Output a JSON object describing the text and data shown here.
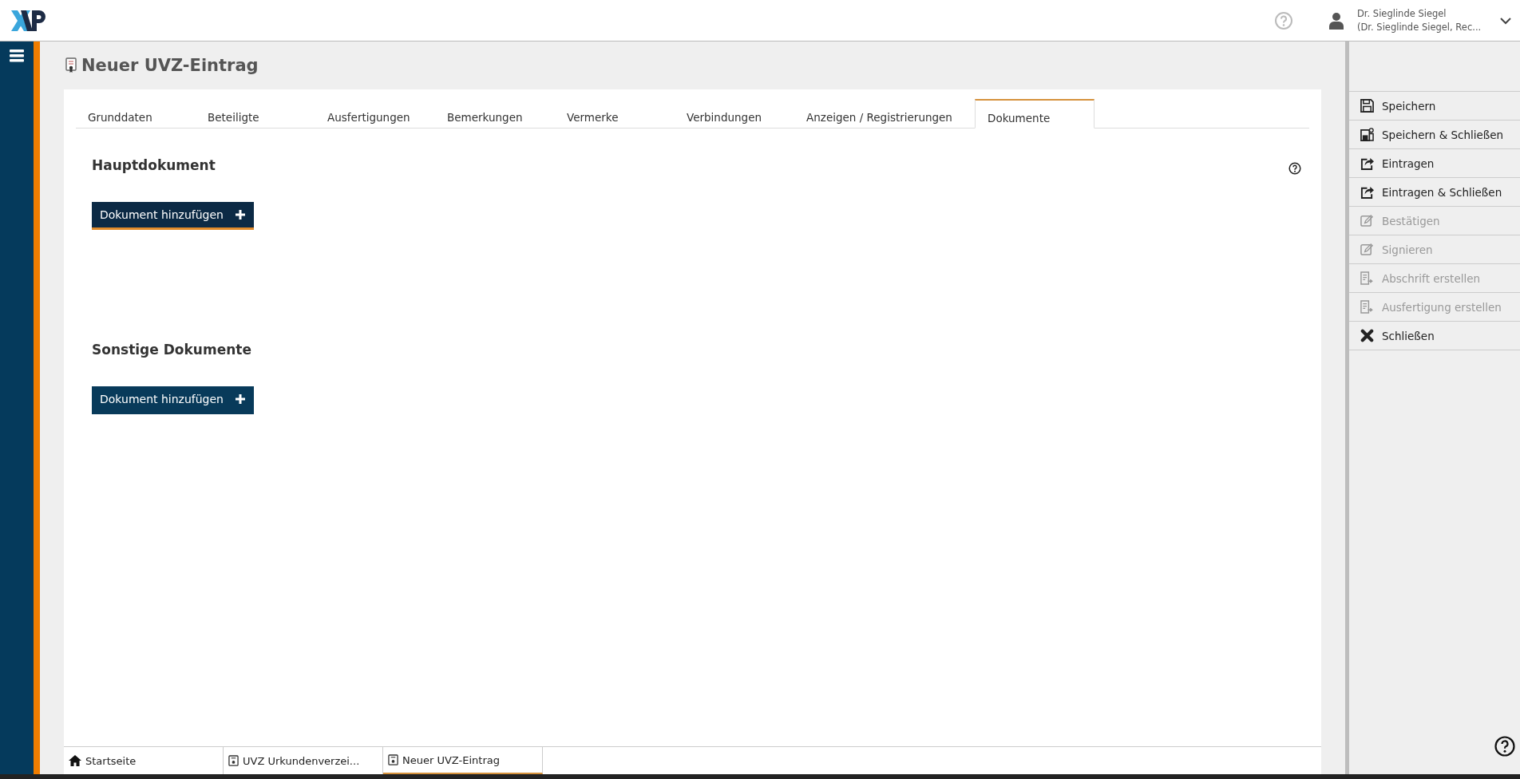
{
  "header": {
    "user_name": "Dr. Sieglinde Siegel",
    "user_role": "(Dr. Sieglinde Siegel, Rec..."
  },
  "page": {
    "title": "Neuer UVZ-Eintrag"
  },
  "tabs": [
    {
      "label": "Grunddaten",
      "selected": false
    },
    {
      "label": "Beteiligte",
      "selected": false
    },
    {
      "label": "Ausfertigungen",
      "selected": false
    },
    {
      "label": "Bemerkungen",
      "selected": false
    },
    {
      "label": "Vermerke",
      "selected": false
    },
    {
      "label": "Verbindungen",
      "selected": false
    },
    {
      "label": "Anzeigen / Registrierungen",
      "selected": false
    },
    {
      "label": "Dokumente",
      "selected": true
    }
  ],
  "sections": [
    {
      "heading": "Hauptdokument",
      "button": "Dokument hinzufügen",
      "focused": true
    },
    {
      "heading": "Sonstige Dokumente",
      "button": "Dokument hinzufügen",
      "focused": false
    }
  ],
  "actions": [
    {
      "label": "Speichern",
      "kind": "save",
      "disabled": false
    },
    {
      "label": "Speichern & Schließen",
      "kind": "save-close",
      "disabled": false
    },
    {
      "label": "Eintragen",
      "kind": "share",
      "disabled": false
    },
    {
      "label": "Eintragen & Schließen",
      "kind": "share",
      "disabled": false
    },
    {
      "label": "Bestätigen",
      "kind": "edit",
      "disabled": true
    },
    {
      "label": "Signieren",
      "kind": "edit",
      "disabled": true
    },
    {
      "label": "Abschrift erstellen",
      "kind": "doc",
      "disabled": true
    },
    {
      "label": "Ausfertigung erstellen",
      "kind": "doc",
      "disabled": true
    },
    {
      "label": "Schließen",
      "kind": "close",
      "disabled": false
    }
  ],
  "bottom_tabs": [
    {
      "label": "Startseite",
      "kind": "home",
      "selected": false
    },
    {
      "label": "UVZ Urkundenverzei...",
      "kind": "doc",
      "selected": false
    },
    {
      "label": "Neuer UVZ-Eintrag",
      "kind": "doc",
      "selected": true
    }
  ]
}
